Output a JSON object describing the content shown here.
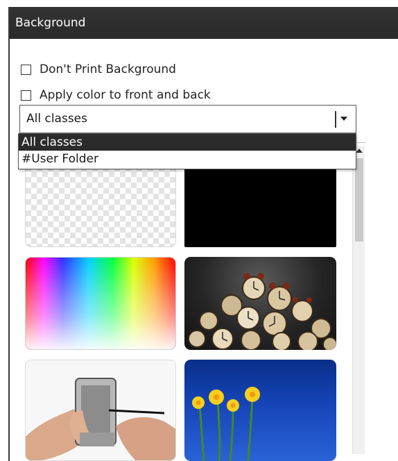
{
  "panel": {
    "title": "Background"
  },
  "options": {
    "dont_print_background": {
      "label": "Don't Print Background",
      "checked": false
    },
    "apply_color_front_back": {
      "label": "Apply color to front and back",
      "checked": false
    }
  },
  "class_select": {
    "value": "All classes",
    "options": [
      {
        "label": "All classes",
        "selected": true
      },
      {
        "label": "#User Folder",
        "selected": false
      }
    ]
  },
  "gallery": {
    "thumbnails": [
      {
        "icon": "transparent-background-thumbnail"
      },
      {
        "icon": "black-background-thumbnail"
      },
      {
        "icon": "color-spectrum-thumbnail"
      },
      {
        "icon": "alarm-clocks-thumbnail"
      },
      {
        "icon": "hands-with-phone-thumbnail"
      },
      {
        "icon": "yellow-daffodils-thumbnail"
      }
    ]
  },
  "colors": {
    "titlebar": "#2e2e2e",
    "dropdown_selected": "#2b2b2b",
    "flowers_sky": "#1645b8"
  }
}
